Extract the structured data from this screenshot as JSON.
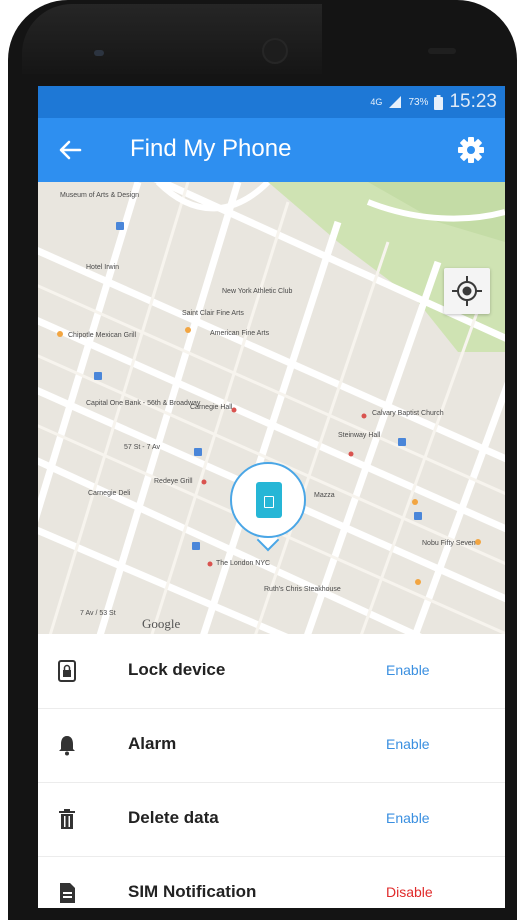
{
  "statusbar": {
    "network_label": "4G",
    "battery_percent": "73%",
    "time": "15:23"
  },
  "appbar": {
    "title": "Find My Phone"
  },
  "map": {
    "labels": [
      "Museum of Arts & Design",
      "Hotel Irwin",
      "New York Athletic Club",
      "Saint Clair Fine Arts",
      "American Fine Arts",
      "Chipotle Mexican Grill",
      "Capital One Bank - 56th & Broadway",
      "Carnegie Hall",
      "Calvary Baptist Church",
      "Steinway Hall",
      "57 St - 7 Av",
      "Carnegie Deli",
      "Redeye Grill",
      "Mazza",
      "The London NYC",
      "Nobu Fifty Seven",
      "Ruth's Chris Steakhouse",
      "7 Av / 53 St"
    ],
    "attribution": "Google"
  },
  "actions": [
    {
      "label": "Lock device",
      "status": "Enable",
      "icon": "lock-device-icon"
    },
    {
      "label": "Alarm",
      "status": "Enable",
      "icon": "bell-icon"
    },
    {
      "label": "Delete data",
      "status": "Enable",
      "icon": "trash-icon"
    },
    {
      "label": "SIM Notification",
      "status": "Disable",
      "icon": "sim-card-icon"
    }
  ],
  "colors": {
    "statusbar": "#1e78d6",
    "appbar": "#2e8ff0",
    "enable": "#3a8fe0",
    "disable": "#e02b2b",
    "marker": "#26b6d6"
  }
}
